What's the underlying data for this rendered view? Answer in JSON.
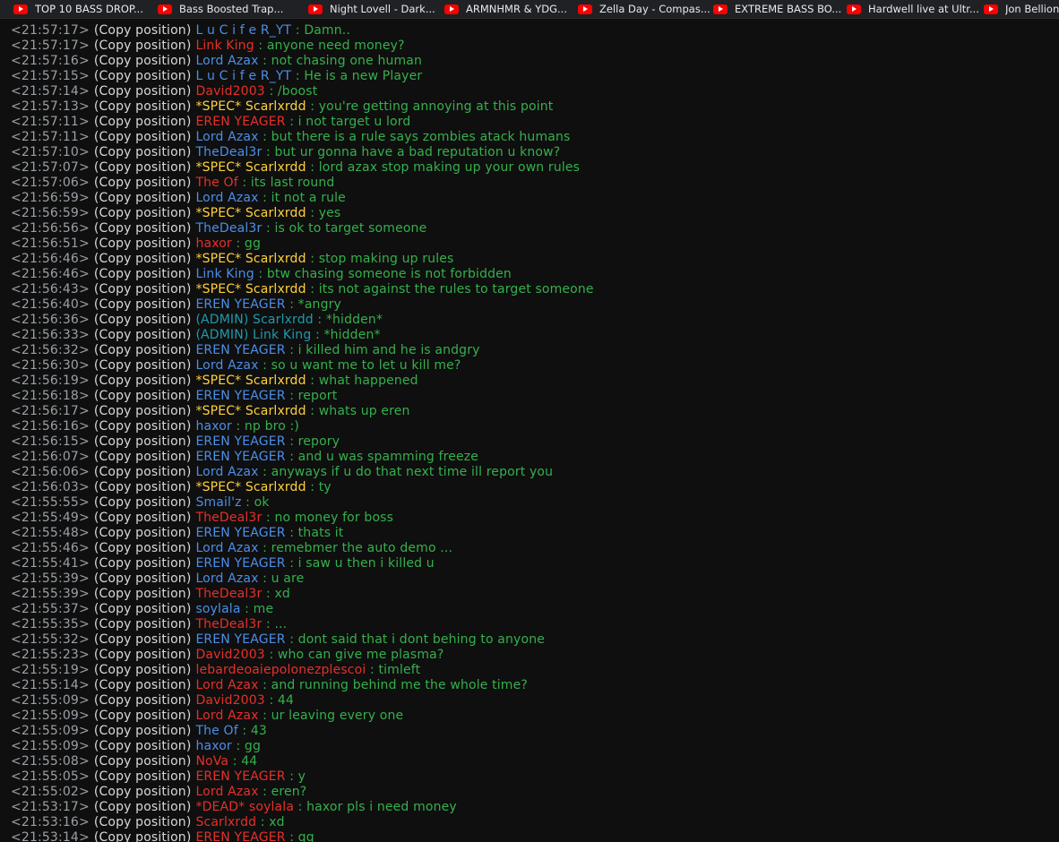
{
  "colors": {
    "red": "#e5302a",
    "blue": "#4c8ee8",
    "yellow": "#ffd13a",
    "teal": "#1f9aab",
    "message": "#35b04c",
    "timestamp": "#9aa0a6",
    "copy": "#d8d8d8"
  },
  "bookmarks": [
    {
      "label": "TOP 10 BASS DROP...",
      "icon": "youtube-icon"
    },
    {
      "label": "Bass Boosted Trap...",
      "icon": "youtube-icon"
    },
    {
      "label": "Night Lovell - Dark...",
      "icon": "youtube-icon"
    },
    {
      "label": "ARMNHMR & YDG...",
      "icon": "youtube-icon"
    },
    {
      "label": "Zella Day - Compas...",
      "icon": "youtube-icon"
    },
    {
      "label": "EXTREME BASS BO...",
      "icon": "youtube-icon"
    },
    {
      "label": "Hardwell live at Ultr...",
      "icon": "youtube-icon"
    },
    {
      "label": "Jon Bellion -",
      "icon": "youtube-icon"
    }
  ],
  "chat": [
    {
      "time": "<21:57:17>",
      "copy": "(Copy position)",
      "name": "L u C i f e R_YT",
      "color": "blue",
      "text": "Damn.."
    },
    {
      "time": "<21:57:17>",
      "copy": "(Copy position)",
      "name": "Link King",
      "color": "red",
      "text": "anyone need money?"
    },
    {
      "time": "<21:57:16>",
      "copy": "(Copy position)",
      "name": "Lord Azax",
      "color": "blue",
      "text": "not chasing one human"
    },
    {
      "time": "<21:57:15>",
      "copy": "(Copy position)",
      "name": "L u C i f e R_YT",
      "color": "blue",
      "text": "He is a new Player"
    },
    {
      "time": "<21:57:14>",
      "copy": "(Copy position)",
      "name": "David2003",
      "color": "red",
      "text": "/boost"
    },
    {
      "time": "<21:57:13>",
      "copy": "(Copy position)",
      "name": "*SPEC* Scarlxrdd",
      "color": "yellow",
      "text": "you're getting annoying at this point"
    },
    {
      "time": "<21:57:11>",
      "copy": "(Copy position)",
      "name": "EREN YEAGER",
      "color": "red",
      "text": "i not target u lord"
    },
    {
      "time": "<21:57:11>",
      "copy": "(Copy position)",
      "name": "Lord Azax",
      "color": "blue",
      "text": "but there is a rule says zombies atack humans"
    },
    {
      "time": "<21:57:10>",
      "copy": "(Copy position)",
      "name": "TheDeal3r",
      "color": "blue",
      "text": "but ur gonna have a bad reputation u know?"
    },
    {
      "time": "<21:57:07>",
      "copy": "(Copy position)",
      "name": "*SPEC* Scarlxrdd",
      "color": "yellow",
      "text": "lord azax stop making up your own rules"
    },
    {
      "time": "<21:57:06>",
      "copy": "(Copy position)",
      "name": "The Of",
      "color": "red",
      "text": "its last round"
    },
    {
      "time": "<21:56:59>",
      "copy": "(Copy position)",
      "name": "Lord Azax",
      "color": "blue",
      "text": "it not a rule"
    },
    {
      "time": "<21:56:59>",
      "copy": "(Copy position)",
      "name": "*SPEC* Scarlxrdd",
      "color": "yellow",
      "text": "yes"
    },
    {
      "time": "<21:56:56>",
      "copy": "(Copy position)",
      "name": "TheDeal3r",
      "color": "blue",
      "text": "is ok to target someone"
    },
    {
      "time": "<21:56:51>",
      "copy": "(Copy position)",
      "name": "haxor",
      "color": "red",
      "text": "gg"
    },
    {
      "time": "<21:56:46>",
      "copy": "(Copy position)",
      "name": "*SPEC* Scarlxrdd",
      "color": "yellow",
      "text": "stop making up rules"
    },
    {
      "time": "<21:56:46>",
      "copy": "(Copy position)",
      "name": "Link King",
      "color": "blue",
      "text": "btw chasing someone is not forbidden"
    },
    {
      "time": "<21:56:43>",
      "copy": "(Copy position)",
      "name": "*SPEC* Scarlxrdd",
      "color": "yellow",
      "text": "its not against the rules to target someone"
    },
    {
      "time": "<21:56:40>",
      "copy": "(Copy position)",
      "name": "EREN YEAGER",
      "color": "blue",
      "text": "*angry"
    },
    {
      "time": "<21:56:36>",
      "copy": "(Copy position)",
      "name": "(ADMIN) Scarlxrdd",
      "color": "teal",
      "text": "*hidden*"
    },
    {
      "time": "<21:56:33>",
      "copy": "(Copy position)",
      "name": "(ADMIN) Link King",
      "color": "teal",
      "text": "*hidden*"
    },
    {
      "time": "<21:56:32>",
      "copy": "(Copy position)",
      "name": "EREN YEAGER",
      "color": "blue",
      "text": "i killed him and he is andgry"
    },
    {
      "time": "<21:56:30>",
      "copy": "(Copy position)",
      "name": "Lord Azax",
      "color": "blue",
      "text": "so u want me to let u kill me?"
    },
    {
      "time": "<21:56:19>",
      "copy": "(Copy position)",
      "name": "*SPEC* Scarlxrdd",
      "color": "yellow",
      "text": "what happened"
    },
    {
      "time": "<21:56:18>",
      "copy": "(Copy position)",
      "name": "EREN YEAGER",
      "color": "blue",
      "text": "report"
    },
    {
      "time": "<21:56:17>",
      "copy": "(Copy position)",
      "name": "*SPEC* Scarlxrdd",
      "color": "yellow",
      "text": "whats up eren"
    },
    {
      "time": "<21:56:16>",
      "copy": "(Copy position)",
      "name": "haxor",
      "color": "blue",
      "text": "np bro :)"
    },
    {
      "time": "<21:56:15>",
      "copy": "(Copy position)",
      "name": "EREN YEAGER",
      "color": "blue",
      "text": "repory"
    },
    {
      "time": "<21:56:07>",
      "copy": "(Copy position)",
      "name": "EREN YEAGER",
      "color": "blue",
      "text": "and u was spamming freeze"
    },
    {
      "time": "<21:56:06>",
      "copy": "(Copy position)",
      "name": "Lord Azax",
      "color": "blue",
      "text": "anyways if u do that next time ill report you"
    },
    {
      "time": "<21:56:03>",
      "copy": "(Copy position)",
      "name": "*SPEC* Scarlxrdd",
      "color": "yellow",
      "text": "ty"
    },
    {
      "time": "<21:55:55>",
      "copy": "(Copy position)",
      "name": "Smail'z",
      "color": "blue",
      "text": "ok"
    },
    {
      "time": "<21:55:49>",
      "copy": "(Copy position)",
      "name": "TheDeal3r",
      "color": "red",
      "text": "no money for boss"
    },
    {
      "time": "<21:55:48>",
      "copy": "(Copy position)",
      "name": "EREN YEAGER",
      "color": "blue",
      "text": "thats it"
    },
    {
      "time": "<21:55:46>",
      "copy": "(Copy position)",
      "name": "Lord Azax",
      "color": "blue",
      "text": "remebmer the auto demo ..."
    },
    {
      "time": "<21:55:41>",
      "copy": "(Copy position)",
      "name": "EREN YEAGER",
      "color": "blue",
      "text": "i saw u then i killed u"
    },
    {
      "time": "<21:55:39>",
      "copy": "(Copy position)",
      "name": "Lord Azax",
      "color": "blue",
      "text": "u are"
    },
    {
      "time": "<21:55:39>",
      "copy": "(Copy position)",
      "name": "TheDeal3r",
      "color": "red",
      "text": "xd"
    },
    {
      "time": "<21:55:37>",
      "copy": "(Copy position)",
      "name": "soylala",
      "color": "blue",
      "text": "me"
    },
    {
      "time": "<21:55:35>",
      "copy": "(Copy position)",
      "name": "TheDeal3r",
      "color": "red",
      "text": "..."
    },
    {
      "time": "<21:55:32>",
      "copy": "(Copy position)",
      "name": "EREN YEAGER",
      "color": "blue",
      "text": "dont said that i dont behing to anyone"
    },
    {
      "time": "<21:55:23>",
      "copy": "(Copy position)",
      "name": "David2003",
      "color": "red",
      "text": "who can give me plasma?"
    },
    {
      "time": "<21:55:19>",
      "copy": "(Copy position)",
      "name": "lebardeoaiepolonezplescoi",
      "color": "red",
      "text": "timleft"
    },
    {
      "time": "<21:55:14>",
      "copy": "(Copy position)",
      "name": "Lord Azax",
      "color": "red",
      "text": "and running behind me the whole time?"
    },
    {
      "time": "<21:55:09>",
      "copy": "(Copy position)",
      "name": "David2003",
      "color": "red",
      "text": "44"
    },
    {
      "time": "<21:55:09>",
      "copy": "(Copy position)",
      "name": "Lord Azax",
      "color": "red",
      "text": "ur leaving every one"
    },
    {
      "time": "<21:55:09>",
      "copy": "(Copy position)",
      "name": "The Of",
      "color": "blue",
      "text": "43"
    },
    {
      "time": "<21:55:09>",
      "copy": "(Copy position)",
      "name": "haxor",
      "color": "blue",
      "text": "gg"
    },
    {
      "time": "<21:55:08>",
      "copy": "(Copy position)",
      "name": "NoVa",
      "color": "red",
      "text": "44"
    },
    {
      "time": "<21:55:05>",
      "copy": "(Copy position)",
      "name": "EREN YEAGER",
      "color": "red",
      "text": "y"
    },
    {
      "time": "<21:55:02>",
      "copy": "(Copy position)",
      "name": "Lord Azax",
      "color": "red",
      "text": "eren?"
    },
    {
      "time": "<21:53:17>",
      "copy": "(Copy position)",
      "name": "*DEAD* soylala",
      "color": "red",
      "text": "haxor pls i need money"
    },
    {
      "time": "<21:53:16>",
      "copy": "(Copy position)",
      "name": "Scarlxrdd",
      "color": "red",
      "text": "xd"
    },
    {
      "time": "<21:53:14>",
      "copy": "(Copy position)",
      "name": "EREN YEAGER",
      "color": "red",
      "text": "gg"
    }
  ]
}
